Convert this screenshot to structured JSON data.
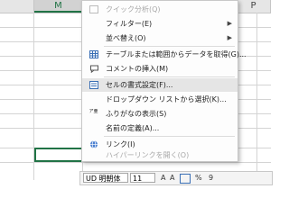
{
  "columns": {
    "m": "M",
    "p": "P"
  },
  "menu": {
    "items": [
      {
        "label": "クイック分析(Q)",
        "disabled": true,
        "icon": "quick-analysis-icon"
      },
      {
        "label": "フィルター(E)",
        "submenu": true
      },
      {
        "label": "並べ替え(O)",
        "submenu": true
      },
      {
        "label": "テーブルまたは範囲からデータを取得(G)...",
        "icon": "table-icon"
      },
      {
        "label": "コメントの挿入(M)",
        "icon": "comment-icon"
      },
      {
        "label": "セルの書式設定(F)...",
        "icon": "format-cells-icon",
        "hover": true
      },
      {
        "label": "ドロップダウン リストから選択(K)..."
      },
      {
        "label": "ふりがなの表示(S)",
        "icon": "furigana-icon"
      },
      {
        "label": "名前の定義(A)..."
      },
      {
        "label": "リンク(I)",
        "icon": "link-icon"
      },
      {
        "label": "ハイパーリンクを開く(O)",
        "disabled": true
      }
    ],
    "submenu_glyph": "▶",
    "furigana_glyph": "ア亜"
  },
  "minibar": {
    "font": "UD 明朝体",
    "size": "11",
    "grow": "A",
    "shrink": "A",
    "percent": "%",
    "comma": "9"
  }
}
